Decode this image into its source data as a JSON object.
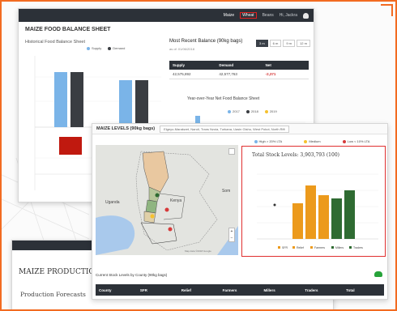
{
  "nav": {
    "items": [
      "Maize",
      "Wheat",
      "Beans"
    ],
    "active": "Maize",
    "highlighted": "Wheat",
    "user": "Hi, Jackra"
  },
  "food_balance": {
    "page_title": "MAIZE FOOD BALANCE SHEET",
    "chart_title": "Historical Food Balance Sheet",
    "legend": [
      "Supply",
      "Demand"
    ],
    "colors": {
      "supply": "#7ab4e8",
      "demand": "#3a3d42",
      "deficit": "#c0190f"
    },
    "recent_title": "Most Recent Balance (90kg bags)",
    "recent_date": "as of: 01/06/2018",
    "periods": [
      "3 m",
      "6 m",
      "9 m",
      "12 m"
    ],
    "table_headers": [
      "Supply",
      "Demand",
      "Net"
    ],
    "table_row": [
      "42,575,892",
      "42,577,763",
      "-2,371"
    ],
    "yoy_title": "Year-over-Year Net Food Balance Sheet",
    "yoy_legend": [
      "2017",
      "2018",
      "2019"
    ]
  },
  "maize_levels": {
    "title": "MAIZE LEVELS (90kg bags)",
    "county_filter": "Elgeyo-Marakwet, Nandi, Trans Nzoia, Turkana, Uasin Gishu, West Pokot, North Rift",
    "legend": [
      {
        "label": "High > 20% LTA",
        "color": "#7ab4e8"
      },
      {
        "label": "Medium",
        "color": "#f5c12e"
      },
      {
        "label": "Low < 10% LTA",
        "color": "#d63a3a"
      }
    ],
    "map_labels": [
      "Uganda",
      "Kenya",
      "Som"
    ],
    "map_attribution": "Map data ©2018 Google",
    "total_title": "Total Stock Levels: 3,903,793 (100)",
    "series_labels": [
      "SFR",
      "Relief",
      "Farmers",
      "Millers",
      "Traders"
    ],
    "current_title": "Current Stock Levels by County (90kg bags)",
    "table_headers": [
      "County",
      "SFR",
      "Relief",
      "Farmers",
      "Millers",
      "Traders",
      "Total"
    ]
  },
  "production": {
    "title": "MAIZE PRODUCTION",
    "subtitle": "Production Forecasts"
  }
}
